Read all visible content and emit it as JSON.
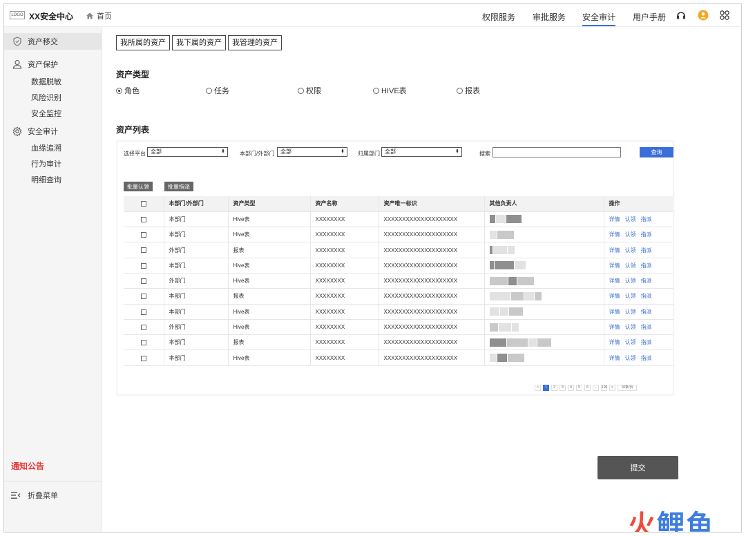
{
  "header": {
    "logo_text": "LOGO",
    "app_title": "XX安全中心",
    "home_label": "首页",
    "nav": [
      "权限服务",
      "审批服务",
      "安全审计",
      "用户手册"
    ],
    "active_nav": "安全审计"
  },
  "sidebar": {
    "groups": [
      {
        "label": "资产移交",
        "icon": "shield-icon",
        "items": []
      },
      {
        "label": "资产保护",
        "icon": "user-icon",
        "items": [
          "数据脱敏",
          "风险识别",
          "安全监控"
        ]
      },
      {
        "label": "安全审计",
        "icon": "gear-icon",
        "items": [
          "血缘追溯",
          "行为审计",
          "明细查询"
        ]
      }
    ],
    "notice": "通知公告",
    "collapse": "折叠菜单"
  },
  "tabs": [
    "我所属的资产",
    "我下属的资产",
    "我管理的资产"
  ],
  "asset_type": {
    "title": "资产类型",
    "options": [
      "角色",
      "任务",
      "权限",
      "HIVE表",
      "报表"
    ],
    "selected": "角色"
  },
  "asset_list": {
    "title": "资产列表",
    "filters": {
      "platform_label": "选择平台",
      "platform_value": "全部",
      "dept_label": "本部门/外部门",
      "dept_value": "全部",
      "owner_dept_label": "归属部门",
      "owner_dept_value": "全部",
      "search_label": "搜索",
      "query_button": "查询"
    },
    "batch_buttons": [
      "批量认领",
      "批量指派"
    ],
    "columns": [
      "本部门/外部门",
      "资产类型",
      "资产名称",
      "资产唯一标识",
      "其他负责人",
      "操作"
    ],
    "rows": [
      {
        "dept": "本部门",
        "type": "Hive表",
        "name": "XXXXXXXX",
        "uid": "XXXXXXXXXXXXXXXXXXXX",
        "external": false
      },
      {
        "dept": "本部门",
        "type": "Hive表",
        "name": "XXXXXXXX",
        "uid": "XXXXXXXXXXXXXXXXXXXX",
        "external": false
      },
      {
        "dept": "外部门",
        "type": "报表",
        "name": "XXXXXXXX",
        "uid": "XXXXXXXXXXXXXXXXXXXX",
        "external": true
      },
      {
        "dept": "本部门",
        "type": "Hive表",
        "name": "XXXXXXXX",
        "uid": "XXXXXXXXXXXXXXXXXXXX",
        "external": false
      },
      {
        "dept": "外部门",
        "type": "Hive表",
        "name": "XXXXXXXX",
        "uid": "XXXXXXXXXXXXXXXXXXXX",
        "external": true
      },
      {
        "dept": "本部门",
        "type": "报表",
        "name": "XXXXXXXX",
        "uid": "XXXXXXXXXXXXXXXXXXXX",
        "external": false
      },
      {
        "dept": "本部门",
        "type": "Hive表",
        "name": "XXXXXXXX",
        "uid": "XXXXXXXXXXXXXXXXXXXX",
        "external": false
      },
      {
        "dept": "外部门",
        "type": "Hive表",
        "name": "XXXXXXXX",
        "uid": "XXXXXXXXXXXXXXXXXXXX",
        "external": true
      },
      {
        "dept": "本部门",
        "type": "报表",
        "name": "XXXXXXXX",
        "uid": "XXXXXXXXXXXXXXXXXXXX",
        "external": false
      },
      {
        "dept": "本部门",
        "type": "Hive表",
        "name": "XXXXXXXX",
        "uid": "XXXXXXXXXXXXXXXXXXXX",
        "external": false
      }
    ],
    "actions": [
      "详情",
      "认领",
      "指派"
    ],
    "pagination": {
      "pages": [
        "1",
        "2",
        "3",
        "4",
        "5",
        "6",
        "...",
        "100"
      ],
      "current": "1",
      "prev": "<",
      "next": ">",
      "page_size": "10条/页"
    }
  },
  "submit_button": "提交",
  "watermark": {
    "first": "火",
    "rest": "鲤鱼"
  }
}
